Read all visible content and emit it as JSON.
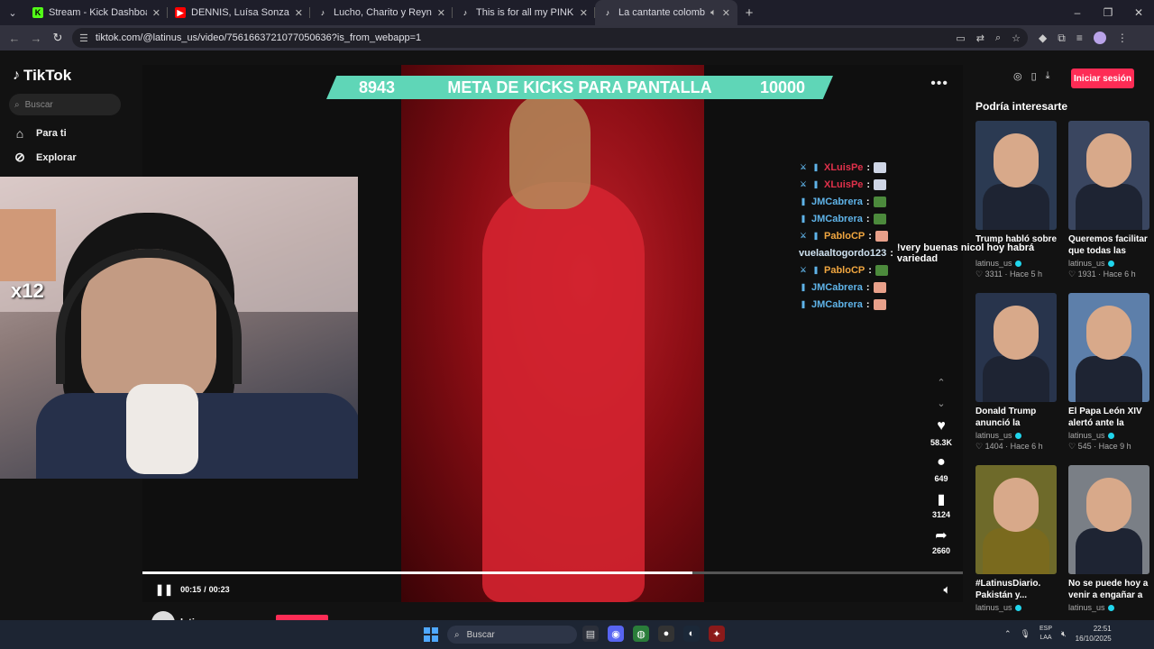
{
  "browser": {
    "tabs": [
      {
        "title": "Stream - Kick Dashboard",
        "icon": "kick-icon",
        "active": false
      },
      {
        "title": "DENNIS, Luísa Sonza - MOTINH",
        "icon": "youtube-icon",
        "active": false
      },
      {
        "title": "Lucho, Charito y Reyna Pachas",
        "icon": "tiktok-icon",
        "active": false
      },
      {
        "title": "This is for all my PINK girls, are",
        "icon": "tiktok-icon",
        "active": false
      },
      {
        "title": "La cantante colombiana Ka",
        "icon": "tiktok-icon",
        "active": true
      }
    ],
    "url": "tiktok.com/@latinus_us/video/7561663721077050636?is_from_webapp=1"
  },
  "tiktok": {
    "logo": "TikTok",
    "search_placeholder": "Buscar",
    "nav": [
      {
        "label": "Para ti",
        "icon": "home-icon"
      },
      {
        "label": "Explorar",
        "icon": "compass-icon"
      }
    ],
    "login_label": "Iniciar sesión",
    "recommend_title": "Podría interesarte",
    "cards": [
      {
        "title": "Trump habló sobre",
        "author": "latinus_us",
        "likes": "3311",
        "time": "Hace 5 h",
        "bg": "#2b3a52"
      },
      {
        "title": "Queremos facilitar que todas las parej...",
        "author": "latinus_us",
        "likes": "1931",
        "time": "Hace 6 h",
        "bg": "#3a4660"
      },
      {
        "title": "Donald Trump anunció la reducció...",
        "author": "latinus_us",
        "likes": "1404",
        "time": "Hace 6 h",
        "bg": "#28344c"
      },
      {
        "title": "El Papa León XIV alertó ante la ONU...",
        "author": "latinus_us",
        "likes": "545",
        "time": "Hace 9 h",
        "bg": "#5d7faa"
      },
      {
        "title": "#LatinusDiario. Pakistán y...",
        "author": "latinus_us",
        "likes": "",
        "time": "",
        "bg": "#6e6a2a"
      },
      {
        "title": "No se puede hoy a venir a engañar a la...",
        "author": "latinus_us",
        "likes": "",
        "time": "",
        "bg": "#7a7f86"
      }
    ],
    "video": {
      "time_current": "00:15",
      "time_total": "00:23",
      "progress": 0.67,
      "author": "latinus_us",
      "likes": "58.3K",
      "comments": "649",
      "saves": "3124",
      "shares": "2660"
    }
  },
  "overlay": {
    "kicks_current": "8943",
    "kicks_label": "META DE KICKS PARA PANTALLA",
    "kicks_goal": "10000",
    "multiplier": "x12",
    "chat": [
      {
        "user": "XLuisPe",
        "color": "#e0314b",
        "badges": 2,
        "emote": "#cfd6e6"
      },
      {
        "user": "XLuisPe",
        "color": "#e0314b",
        "badges": 2,
        "emote": "#cfd6e6"
      },
      {
        "user": "JMCabrera",
        "color": "#5fb3e8",
        "badges": 1,
        "emote": "#4c8a3c"
      },
      {
        "user": "JMCabrera",
        "color": "#5fb3e8",
        "badges": 1,
        "emote": "#4c8a3c"
      },
      {
        "user": "PabloCP",
        "color": "#f0a640",
        "badges": 2,
        "emote": "#e8a08a"
      },
      {
        "user": "vuelaaltogordo123",
        "color": "#cfe2f0",
        "badges": 0,
        "message": "!very buenas nicol hoy habrá variedad"
      },
      {
        "user": "PabloCP",
        "color": "#f0a640",
        "badges": 2,
        "emote": "#4c8a3c"
      },
      {
        "user": "JMCabrera",
        "color": "#5fb3e8",
        "badges": 1,
        "emote": "#e8a08a"
      },
      {
        "user": "JMCabrera",
        "color": "#5fb3e8",
        "badges": 1,
        "emote": "#e8a08a"
      }
    ]
  },
  "taskbar": {
    "search_placeholder": "Buscar",
    "lang": "ESP",
    "lang_sub": "LAA",
    "time": "22:51",
    "date": "16/10/2025"
  }
}
